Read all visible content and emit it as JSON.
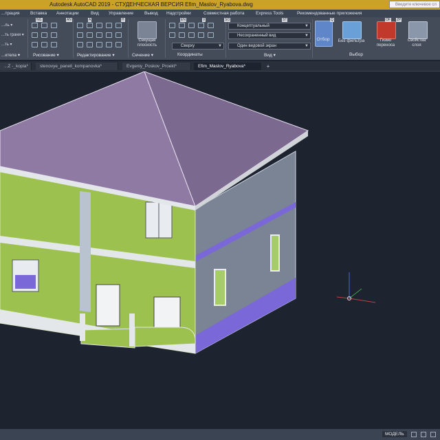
{
  "app": {
    "title": "Autodesk AutoCAD 2019 - СТУДЕНЧЕСКАЯ ВЕРСИЯ   Efim_Maslov_Ryabova.dwg",
    "search_placeholder": "Введите ключевое сл"
  },
  "menu": {
    "items": [
      "...трация",
      "Вставка",
      "Аннотации",
      "Вид",
      "Управление",
      "Вывод",
      "Надстройки",
      "Совместная работа",
      "Express Tools",
      "Рекомендованные приложения"
    ]
  },
  "ribbon": {
    "panels": {
      "modeling": "...ктела ▾",
      "draw": "Рисование ▾",
      "modify": "Редактирование ▾",
      "section": "Сечение ▾",
      "coordinates": "Координаты",
      "view": "Вид ▾",
      "selection": "Выбор"
    },
    "tools": {
      "tool1": "...ль ▾",
      "tool2": "...ть грани ▾",
      "tool3": "...ть ▾",
      "section_plane": "Секущая\nплоскость",
      "visual_style": "Концептуальный",
      "named_view": "Несохраненный вид",
      "view_dir": "Сверху",
      "viewport": "Один видовой экран",
      "culling": "Отбор",
      "no_filter": "Без фильтра",
      "gizmo": "Гизмо\nпереноса",
      "layer_props": "Свойства\nслоя"
    },
    "badges": [
      "NG",
      "AN",
      "A",
      "H",
      "EN",
      "V",
      "SO",
      "ST",
      "Q",
      "OF",
      "ZP"
    ]
  },
  "tabs": [
    {
      "label": "...Z -_kopia*"
    },
    {
      "label": "stenovye_paneli_kompanovka*"
    },
    {
      "label": "Evgeniy_Poskov_Proekt*"
    },
    {
      "label": "Efim_Maslov_Ryabova*"
    }
  ],
  "status": {
    "model": "МОДЕЛЬ"
  },
  "colors": {
    "title_bar": "#c9a227",
    "roof": "#8f7aa3",
    "wall_green": "#9cc14f",
    "wall_gray": "#7a8494",
    "trim_purple": "#7a67d8",
    "viewport_bg": "#1e2330"
  }
}
